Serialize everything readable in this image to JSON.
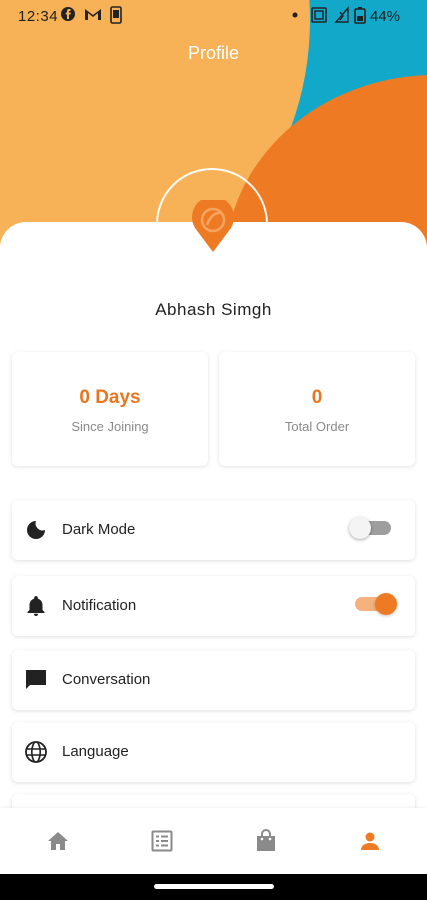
{
  "status_bar": {
    "time": "12:34",
    "battery": "44%",
    "icons": [
      "facebook-icon",
      "gmail-icon",
      "phone-icon",
      "dot-icon",
      "nfc-icon",
      "signal-icon",
      "battery-icon"
    ]
  },
  "header": {
    "title": "Profile"
  },
  "profile": {
    "name": "Abhash Simgh"
  },
  "stats": [
    {
      "value": "0 Days",
      "label": "Since Joining"
    },
    {
      "value": "0",
      "label": "Total Order"
    }
  ],
  "settings": [
    {
      "label": "Dark Mode",
      "icon": "moon-icon",
      "toggle": false
    },
    {
      "label": "Notification",
      "icon": "bell-icon",
      "toggle": true
    },
    {
      "label": "Conversation",
      "icon": "chat-icon"
    },
    {
      "label": "Language",
      "icon": "globe-icon"
    }
  ],
  "bottom_nav": [
    {
      "icon": "home-icon",
      "active": false
    },
    {
      "icon": "list-icon",
      "active": false
    },
    {
      "icon": "shopping-bag-icon",
      "active": false
    },
    {
      "icon": "person-icon",
      "active": true
    }
  ],
  "colors": {
    "accent": "#EE7A24",
    "header_yellow": "#F7B257",
    "header_cyan": "#12A8C9",
    "inactive_icon": "#8a8a8a"
  }
}
